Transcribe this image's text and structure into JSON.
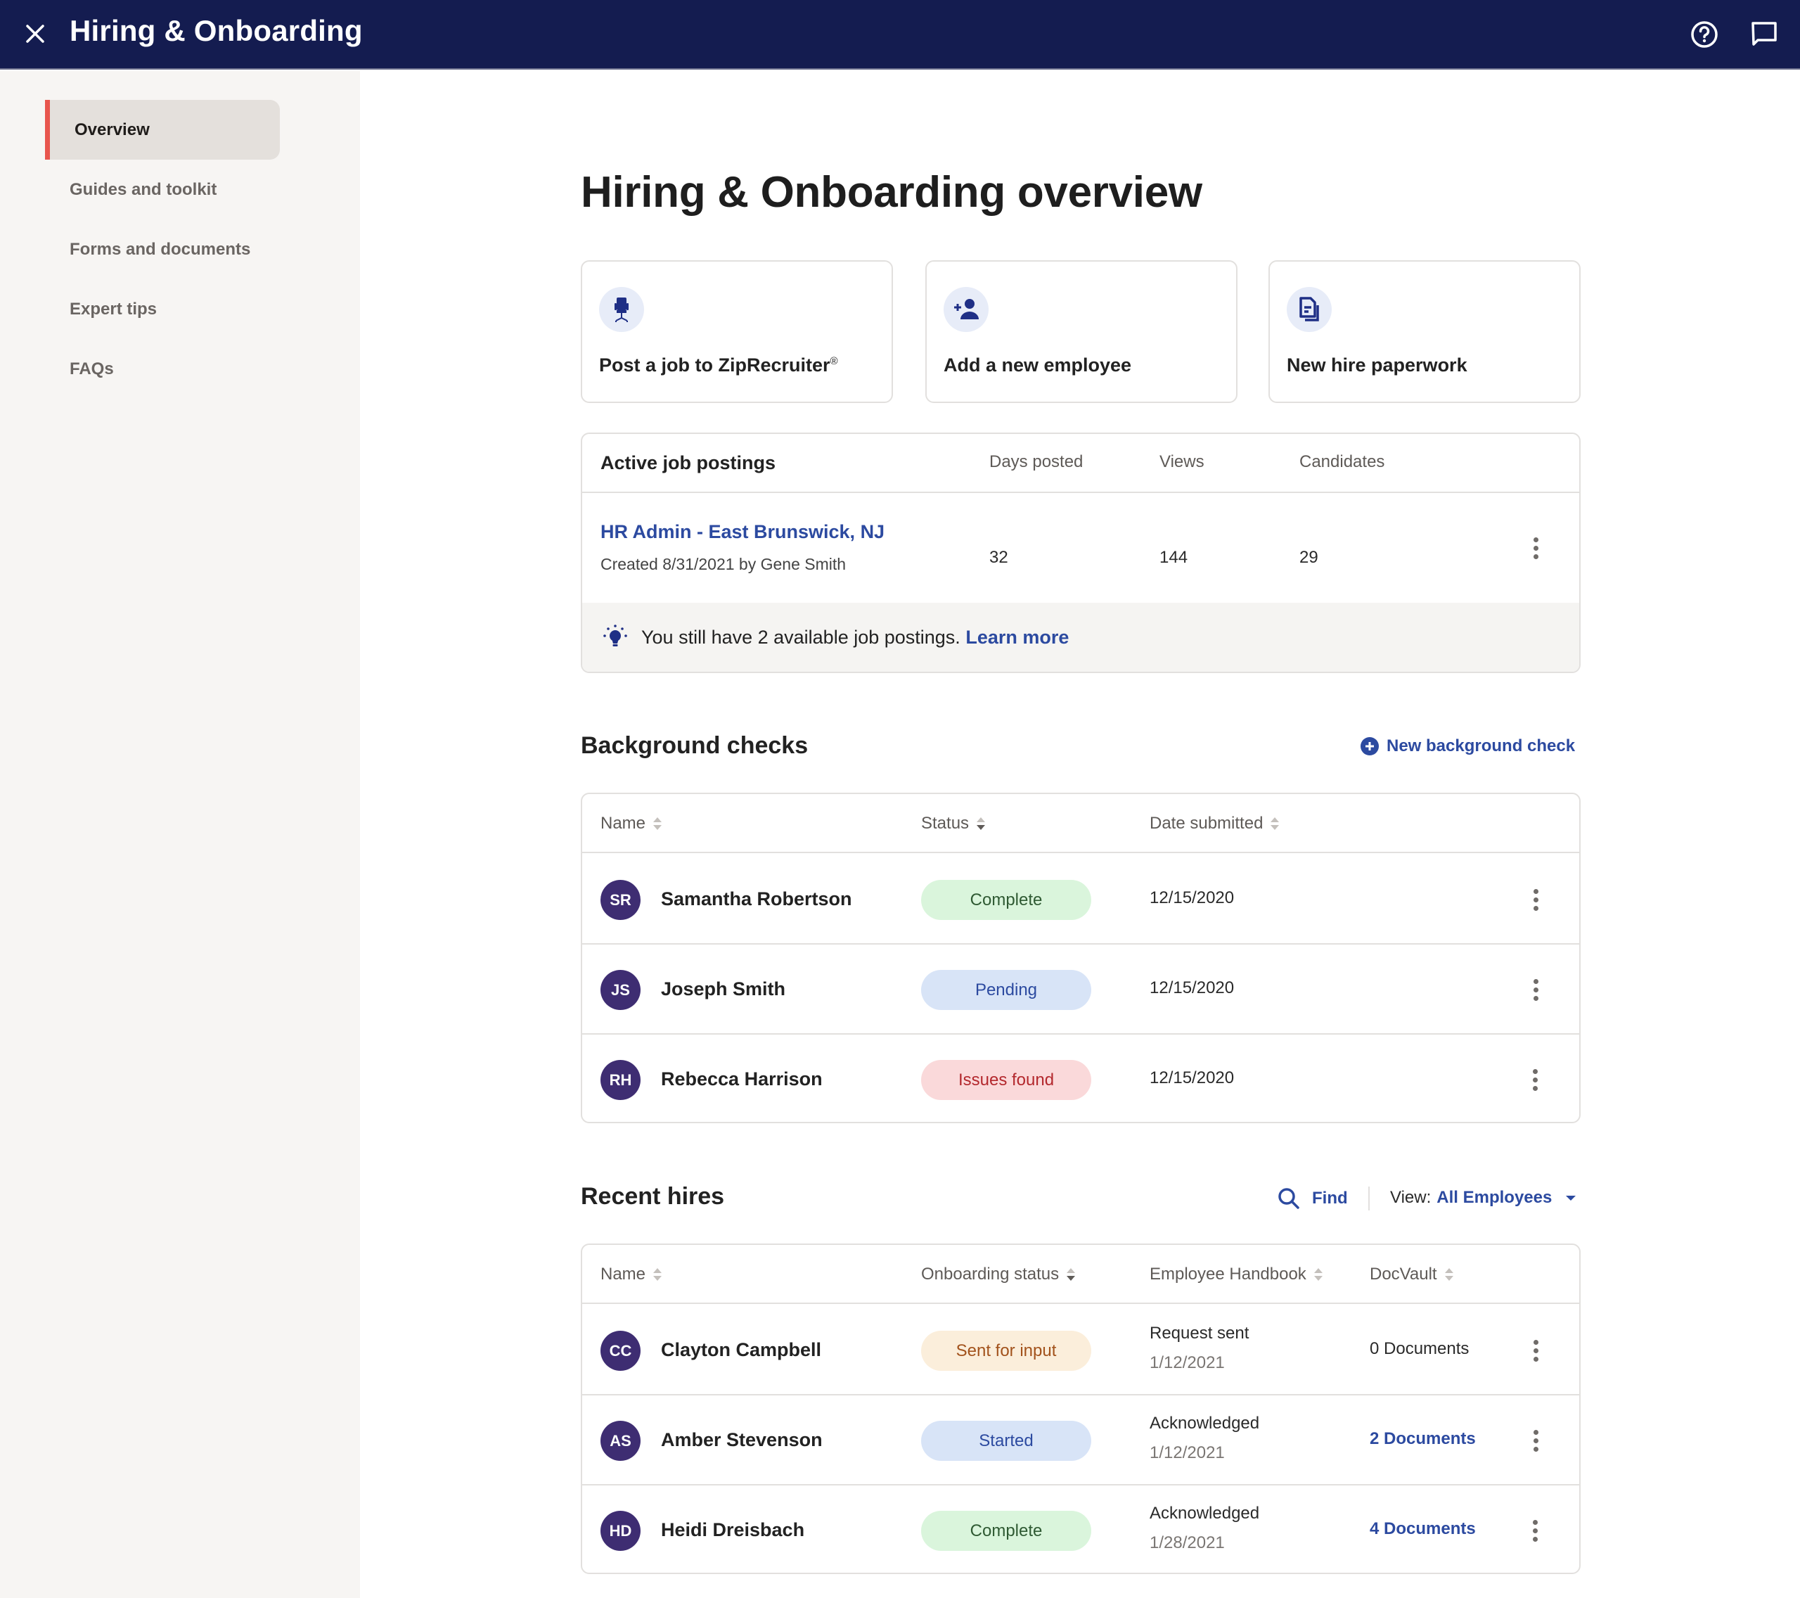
{
  "app": {
    "title": "Hiring & Onboarding",
    "icons": {
      "close": "close-icon",
      "help": "help-circle-icon",
      "chat": "chat-bubble-icon"
    }
  },
  "sidebar": {
    "items": [
      {
        "label": "Overview",
        "active": true
      },
      {
        "label": "Guides and toolkit",
        "active": false
      },
      {
        "label": "Forms and documents",
        "active": false
      },
      {
        "label": "Expert tips",
        "active": false
      },
      {
        "label": "FAQs",
        "active": false
      }
    ]
  },
  "page": {
    "title": "Hiring & Onboarding overview"
  },
  "quick_actions": [
    {
      "label": "Post a job to ZipRecruiter",
      "suffix": "®",
      "icon": "office-chair-icon"
    },
    {
      "label": "Add a new employee",
      "icon": "add-person-icon"
    },
    {
      "label": "New hire paperwork",
      "icon": "documents-icon"
    }
  ],
  "job_postings": {
    "title": "Active job postings",
    "columns": [
      "Days posted",
      "Views",
      "Candidates"
    ],
    "rows": [
      {
        "title": "HR Admin - East Brunswick, NJ",
        "created": "Created 8/31/2021 by Gene Smith",
        "days_posted": "32",
        "views": "144",
        "candidates": "29"
      }
    ],
    "tip": {
      "text": "You still have 2 available job postings.",
      "link": "Learn more",
      "icon": "lightbulb-icon"
    }
  },
  "background_checks": {
    "title": "Background checks",
    "action": "New background check",
    "columns": [
      "Name",
      "Status",
      "Date submitted"
    ],
    "rows": [
      {
        "initials": "SR",
        "name": "Samantha Robertson",
        "status": "Complete",
        "date": "12/15/2020"
      },
      {
        "initials": "JS",
        "name": "Joseph Smith",
        "status": "Pending",
        "date": "12/15/2020"
      },
      {
        "initials": "RH",
        "name": "Rebecca Harrison",
        "status": "Issues found",
        "date": "12/15/2020"
      }
    ]
  },
  "recent_hires": {
    "title": "Recent hires",
    "find_label": "Find",
    "view_label": "View:",
    "view_value": "All Employees",
    "columns": [
      "Name",
      "Onboarding status",
      "Employee Handbook",
      "DocVault"
    ],
    "rows": [
      {
        "initials": "CC",
        "name": "Clayton Campbell",
        "status": "Sent for input",
        "handbook": "Request sent",
        "handbook_date": "1/12/2021",
        "docvault": "0 Documents",
        "docvault_link": false
      },
      {
        "initials": "AS",
        "name": "Amber Stevenson",
        "status": "Started",
        "handbook": "Acknowledged",
        "handbook_date": "1/12/2021",
        "docvault": "2 Documents",
        "docvault_link": true
      },
      {
        "initials": "HD",
        "name": "Heidi Dreisbach",
        "status": "Complete",
        "handbook": "Acknowledged",
        "handbook_date": "1/28/2021",
        "docvault": "4 Documents",
        "docvault_link": true
      }
    ]
  },
  "colors": {
    "topbar": "#141c50",
    "accent_link": "#2c4aa0",
    "active_nav_marker": "#e8554d",
    "avatar": "#3e2d72",
    "status": {
      "Complete": {
        "bg": "#daf5dc",
        "fg": "#2f5a33"
      },
      "Pending": {
        "bg": "#d8e4f7",
        "fg": "#2c4aa0"
      },
      "Started": {
        "bg": "#d8e4f7",
        "fg": "#2c4aa0"
      },
      "Issues found": {
        "bg": "#fad9da",
        "fg": "#b3282d"
      },
      "Sent for input": {
        "bg": "#fbeedb",
        "fg": "#a2521c"
      }
    }
  }
}
